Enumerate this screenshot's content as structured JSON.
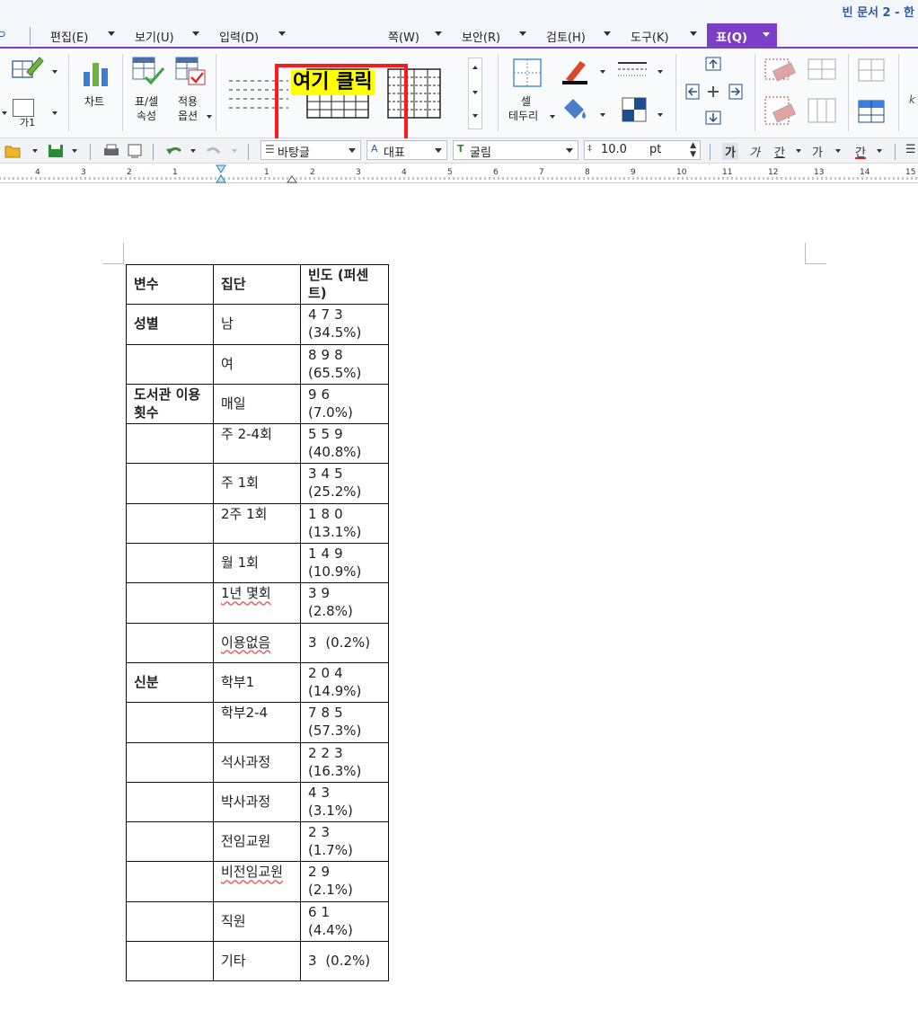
{
  "window": {
    "title": "빈 문서 2 - 한"
  },
  "menu": {
    "items": [
      {
        "label": "편집(E)"
      },
      {
        "label": "보기(U)"
      },
      {
        "label": "입력(D)"
      },
      {
        "label": "쪽(W)"
      },
      {
        "label": "보안(R)"
      },
      {
        "label": "검토(H)"
      },
      {
        "label": "도구(K)"
      }
    ],
    "active": "표(Q)"
  },
  "ribbon": {
    "chart_label": "차트",
    "cell_props_label_1": "표/셀",
    "cell_props_label_2": "속성",
    "apply_options_label_1": "적용",
    "apply_options_label_2": "옵션",
    "cell_border_label_1": "셀",
    "cell_border_label_2": "테두리",
    "text_sample": "가1"
  },
  "callout": {
    "label": "여기 클릭",
    "color": "#ff1a1a",
    "highlight": "#ffff00"
  },
  "format_bar": {
    "style": "바탕글",
    "lang": "대표",
    "font": "굴림",
    "size": "10.0",
    "size_unit": "pt"
  },
  "ruler": {
    "numbers": [
      "4",
      "3",
      "2",
      "1",
      "1",
      "2",
      "3",
      "4",
      "5",
      "6",
      "7",
      "8",
      "9",
      "10",
      "11",
      "12",
      "13",
      "14",
      "15"
    ]
  },
  "table": {
    "headers": [
      "변수",
      "집단",
      "빈도 (퍼센트)"
    ],
    "rows": [
      {
        "var": "성별",
        "group": "남",
        "freq": "473",
        "pct": "(34.5%)"
      },
      {
        "var": "",
        "group": "여",
        "freq": "898",
        "pct": "(65.5%)"
      },
      {
        "var": "도서관 이용횟수",
        "group": "매일",
        "freq": "96",
        "pct": "(7.0%)"
      },
      {
        "var": "",
        "group": "주 2-4회",
        "freq": "559",
        "pct": "(40.8%)"
      },
      {
        "var": "",
        "group": "주 1회",
        "freq": "345",
        "pct": "(25.2%)"
      },
      {
        "var": "",
        "group": "2주 1회",
        "freq": "180",
        "pct": "(13.1%)"
      },
      {
        "var": "",
        "group": "월 1회",
        "freq": "149",
        "pct": "(10.9%)"
      },
      {
        "var": "",
        "group": "1년 몇회",
        "freq": "39",
        "pct": "(2.8%)"
      },
      {
        "var": "",
        "group": "이용없음",
        "freq": "3",
        "pct": "(0.2%)"
      },
      {
        "var": "신분",
        "group": "학부1",
        "freq": "204",
        "pct": "(14.9%)"
      },
      {
        "var": "",
        "group": "학부2-4",
        "freq": "785",
        "pct": "(57.3%)"
      },
      {
        "var": "",
        "group": "석사과정",
        "freq": "223",
        "pct": "(16.3%)"
      },
      {
        "var": "",
        "group": "박사과정",
        "freq": "43",
        "pct": "(3.1%)"
      },
      {
        "var": "",
        "group": "전임교원",
        "freq": "23",
        "pct": "(1.7%)"
      },
      {
        "var": "",
        "group": "비전임교원",
        "freq": "29",
        "pct": "(2.1%)"
      },
      {
        "var": "",
        "group": "직원",
        "freq": "61",
        "pct": "(4.4%)"
      },
      {
        "var": "",
        "group": "기타",
        "freq": "3",
        "pct": "(0.2%)"
      }
    ]
  }
}
